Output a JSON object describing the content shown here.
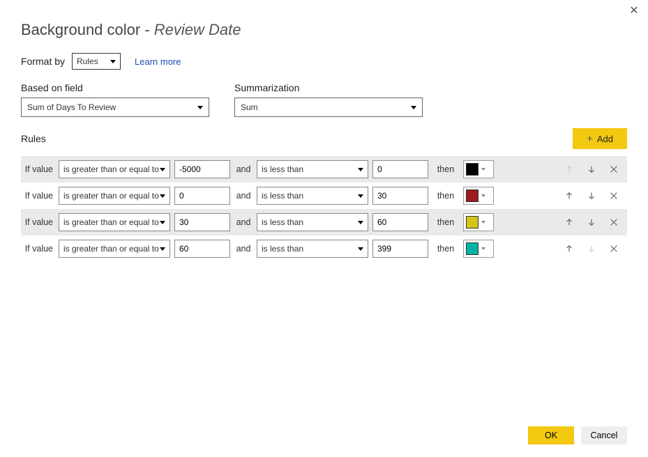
{
  "dialog": {
    "close_glyph": "✕",
    "title_prefix": "Background color - ",
    "title_field": "Review Date"
  },
  "format": {
    "label": "Format by",
    "select": "Rules",
    "learn_more": "Learn more"
  },
  "based_on_field": {
    "label": "Based on field",
    "value": "Sum of Days To Review"
  },
  "summarization": {
    "label": "Summarization",
    "value": "Sum"
  },
  "rules_section": {
    "label": "Rules",
    "add_label": "Add",
    "if_label": "If value",
    "and_label": "and",
    "then_label": "then"
  },
  "rules": [
    {
      "shaded": true,
      "op1": "is greater than or equal to",
      "val1": "-5000",
      "op2": "is less than",
      "val2": "0",
      "color": "#000000",
      "up_disabled": true,
      "down_disabled": false
    },
    {
      "shaded": false,
      "op1": "is greater than or equal to",
      "val1": "0",
      "op2": "is less than",
      "val2": "30",
      "color": "#9b1c1c",
      "up_disabled": false,
      "down_disabled": false
    },
    {
      "shaded": true,
      "op1": "is greater than or equal to",
      "val1": "30",
      "op2": "is less than",
      "val2": "60",
      "color": "#d6c316",
      "up_disabled": false,
      "down_disabled": false
    },
    {
      "shaded": false,
      "op1": "is greater than or equal to",
      "val1": "60",
      "op2": "is less than",
      "val2": "399",
      "color": "#00b3a4",
      "up_disabled": false,
      "down_disabled": true
    }
  ],
  "footer": {
    "ok": "OK",
    "cancel": "Cancel"
  }
}
